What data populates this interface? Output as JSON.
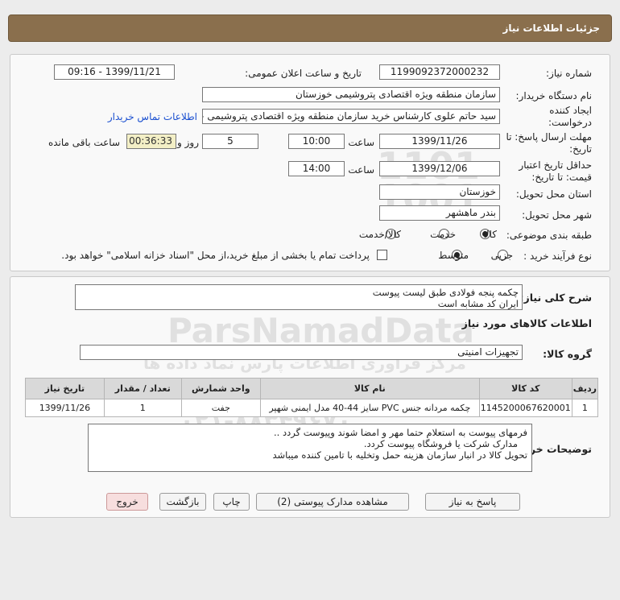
{
  "header": {
    "title": "جزئیات اطلاعات نیاز"
  },
  "details": {
    "need_number_label": "شماره نیاز:",
    "need_number": "1199092372000232",
    "announce_label": "تاریخ و ساعت اعلان عمومی:",
    "announce_value": "1399/11/21 - 09:16",
    "buyer_org_label": "نام دستگاه خریدار:",
    "buyer_org": "سازمان منطقه ویژه اقتصادی پتروشیمی خوزستان",
    "creator_label": "ایجاد کننده درخواست:",
    "creator": "سید حاتم علوی کارشناس خرید سازمان منطقه ویژه اقتصادی پتروشیمی خوزستان",
    "contact_link": "اطلاعات تماس خریدار",
    "deadline_label": "مهلت ارسال پاسخ: تا تاریخ:",
    "deadline_date": "1399/11/26",
    "time_label": "ساعت",
    "deadline_time": "10:00",
    "days_value": "5",
    "days_label": "روز و",
    "timer": "00:36:33",
    "remaining_label": "ساعت باقی مانده",
    "validity_label": "حداقل تاریخ اعتبار قیمت: تا تاریخ:",
    "validity_date": "1399/12/06",
    "validity_time": "14:00",
    "province_label": "استان محل تحویل:",
    "province": "خوزستان",
    "city_label": "شهر محل تحویل:",
    "city": "بندر ماهشهر",
    "category_label": "طبقه بندی موضوعی:",
    "category_options": [
      "کالا",
      "خدمت",
      "کالا/خدمت"
    ],
    "process_label": "نوع فرآیند خرید :",
    "process_options": [
      "جزیی",
      "متوسط"
    ],
    "payment_note": "پرداخت تمام یا بخشی از مبلغ خرید،از محل \"اسناد خزانه اسلامی\" خواهد بود."
  },
  "summary": {
    "title_label": "شرح کلی نیاز:",
    "line1": "چکمه پنجه فولادی طبق لیست پیوست",
    "line2": "ایران کد مشابه است"
  },
  "goods": {
    "section_title": "اطلاعات کالاهای مورد نیاز",
    "group_label": "گروه کالا:",
    "group_value": "تجهیزات امنیتی",
    "columns": [
      "ردیف",
      "کد کالا",
      "نام کالا",
      "واحد شمارش",
      "تعداد / مقدار",
      "تاریخ نیاز"
    ],
    "rows": [
      [
        "1",
        "1145200067620001",
        "چکمه مردانه جنس PVC سایز 44-40 مدل ایمنی شهپر",
        "جفت",
        "1",
        "1399/11/26"
      ]
    ]
  },
  "notes": {
    "label": "توضیحات خریدار:",
    "line1": "فرمهای پیوست به استعلام حتما مهر و امضا شوند وپیوست گردد ..",
    "line2": "مدارک شرکت یا فروشگاه پیوست کردد.",
    "line3": "تحویل کالا در انبار سازمان هزینه حمل وتخلیه با تامین کننده میباشد"
  },
  "buttons": {
    "reply": "پاسخ به نیاز",
    "docs": "مشاهده مدارک پیوستی (2)",
    "print": "چاپ",
    "back": "بازگشت",
    "exit": "خروج"
  },
  "watermark": {
    "brand": "ParsNamadData",
    "line_fa": "مرکز فرآوری اطلاعات پارس نماد داده ها",
    "line_fa2": "پایگاه اطلاع رسانی مناقصه و مزایده",
    "phone": "۰۲۱-۸۸۳۴۹۶۷۰"
  },
  "colors": {
    "header_bg": "#8a6f4d",
    "link": "#1a4fd0",
    "timer_bg": "#f3efc6"
  }
}
